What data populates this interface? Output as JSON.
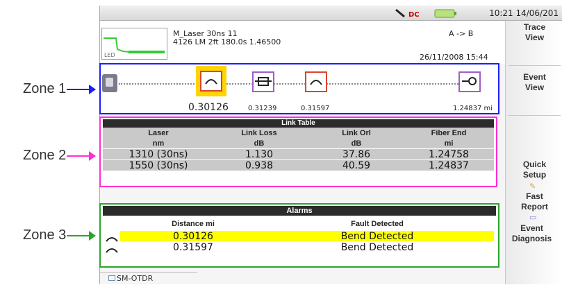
{
  "zones": {
    "zone1_label": "Zone 1",
    "zone2_label": "Zone 2",
    "zone3_label": "Zone 3"
  },
  "colors": {
    "zone1": "#1c1cff",
    "zone2": "#ff2fd0",
    "zone3": "#2aa52a",
    "highlight": "#ffff00"
  },
  "status": {
    "time": "10:21 14/06/201"
  },
  "header": {
    "line1": "M_Laser  30ns   11",
    "line2": "4126 LM  2ft  180.0s  1.46500",
    "direction": "A -> B",
    "datetime": "26/11/2008  15:44",
    "thumb_label": "LED"
  },
  "sidebar": {
    "trace_view": "Trace View",
    "event_view": "Event View",
    "quick_setup": "Quick Setup",
    "fast_report": "Fast Report",
    "event_diagnosis": "Event Diagnosis"
  },
  "link_diagram": {
    "events": [
      {
        "label": "0.30126",
        "icon": "bend-icon"
      },
      {
        "label": "0.31239",
        "icon": "connector-icon"
      },
      {
        "label": "0.31597",
        "icon": "bend-icon"
      },
      {
        "label": "1.24837 mi",
        "icon": "fiber-end-icon"
      }
    ]
  },
  "link_table": {
    "title": "Link Table",
    "headers": [
      "Laser",
      "Link Loss",
      "Link Orl",
      "Fiber End"
    ],
    "units": [
      "nm",
      "dB",
      "dB",
      "mi"
    ],
    "rows": [
      [
        "1310 (30ns)",
        "1.130",
        "37.86",
        "1.24758"
      ],
      [
        "1550 (30ns)",
        "0.938",
        "40.59",
        "1.24837"
      ]
    ]
  },
  "alarms": {
    "title": "Alarms",
    "headers": [
      "Distance mi",
      "Fault Detected"
    ],
    "rows": [
      {
        "distance": "0.30126",
        "fault": "Bend Detected",
        "highlighted": true
      },
      {
        "distance": "0.31597",
        "fault": "Bend Detected",
        "highlighted": false
      }
    ]
  },
  "tab": {
    "label": "SM-OTDR"
  }
}
